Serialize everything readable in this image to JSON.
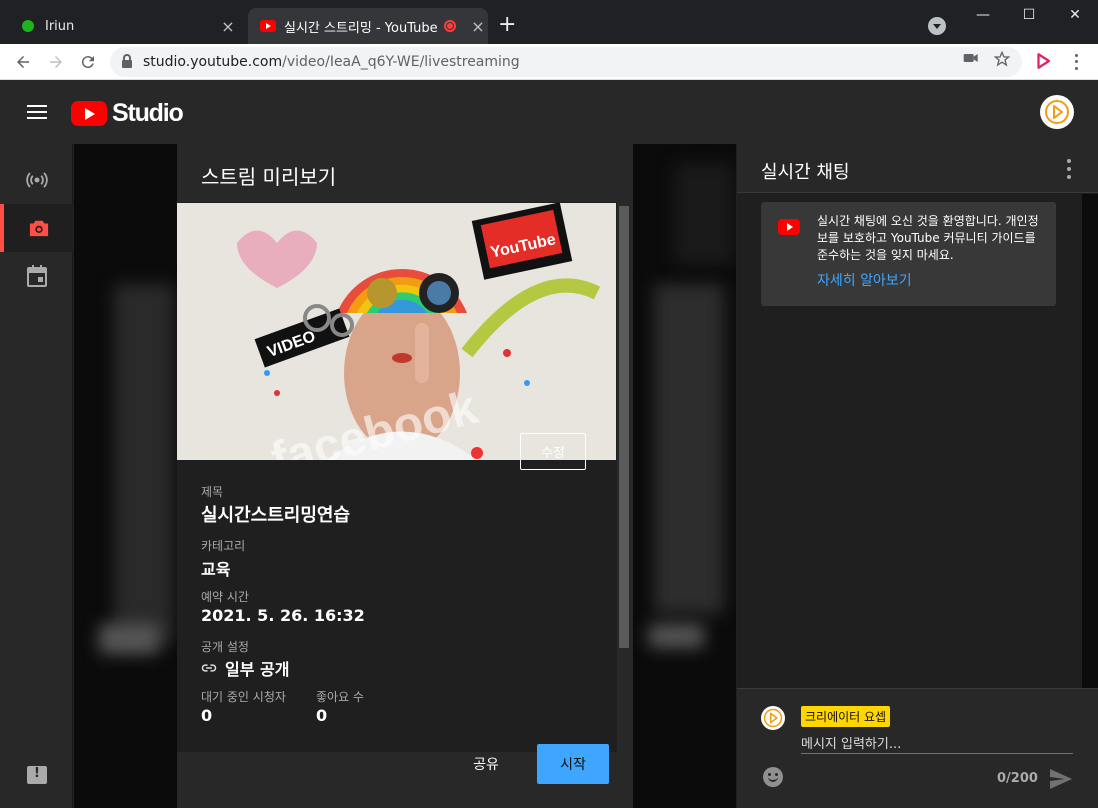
{
  "browser": {
    "tabs": [
      {
        "title": "Iriun",
        "close": "×"
      },
      {
        "title": "실시간 스트리밍 - YouTube",
        "close": "×"
      }
    ],
    "new_tab": "+",
    "url_host": "studio.youtube.com",
    "url_path": "/video/IeaA_q6Y-WE/livestreaming",
    "window": {
      "minimize": "—",
      "maximize": "☐",
      "close": "✕"
    }
  },
  "studio": {
    "logo_text": "Studio"
  },
  "dialog": {
    "title": "스트림 미리보기",
    "fields": {
      "title_label": "제목",
      "title_value": "실시간스트리밍연습",
      "category_label": "카테고리",
      "category_value": "교육",
      "schedule_label": "예약 시간",
      "schedule_value": "2021. 5. 26. 16:32",
      "visibility_label": "공개 설정",
      "visibility_value": "일부 공개",
      "waiting_label": "대기 중인 시청자",
      "waiting_value": "0",
      "likes_label": "좋아요 수",
      "likes_value": "0"
    },
    "edit_label": "수정",
    "share_label": "공유",
    "start_label": "시작"
  },
  "chat": {
    "title": "실시간 채팅",
    "welcome_text": "실시간 채팅에 오신 것을 환영합니다. 개인정보를 보호하고 YouTube 커뮤니티 가이드를 준수하는 것을 잊지 마세요.",
    "welcome_link": "자세히 알아보기",
    "author_badge": "크리에이터 요셉",
    "input_placeholder": "메시지 입력하기...",
    "counter": "0/200"
  },
  "colors": {
    "accent_blue": "#3ea6ff",
    "youtube_red": "#ff0000",
    "active_rail": "#ff4e45",
    "badge_yellow": "#ffd600"
  },
  "icons": {
    "rail": [
      "live-broadcast-icon",
      "camera-icon",
      "calendar-icon"
    ],
    "bottom": "feedback-icon"
  }
}
